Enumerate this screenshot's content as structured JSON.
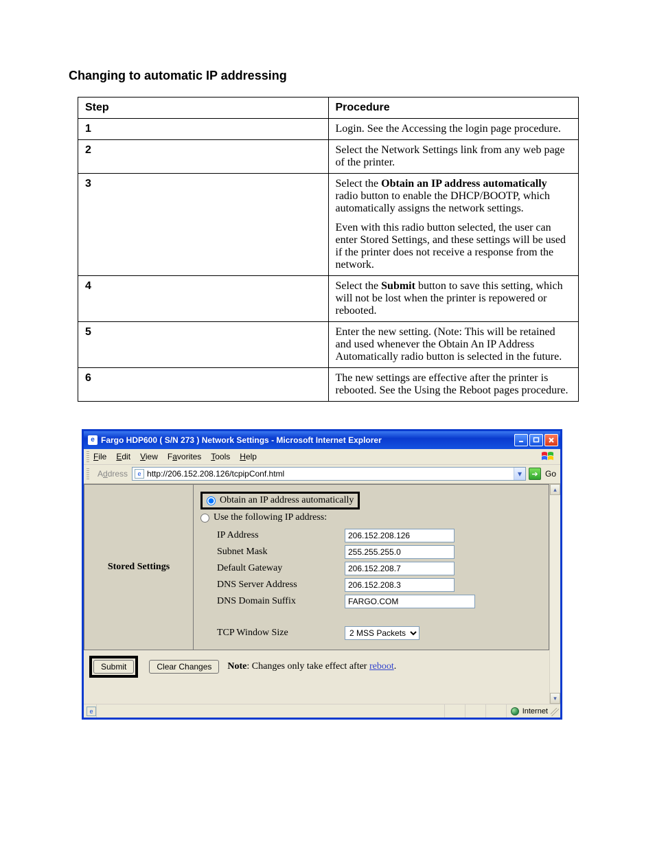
{
  "section_title": "Changing to automatic IP addressing",
  "table": {
    "header_step": "Step",
    "header_proc": "Procedure",
    "rows": [
      {
        "num": "1",
        "text": "Login. See the Accessing the login page procedure."
      },
      {
        "num": "2",
        "text": "Select the Network Settings link from any web page of the printer."
      },
      {
        "num": "3",
        "text_html": "Select the <b>Obtain an IP address automatically</b> radio button to enable the DHCP/BOOTP, which automatically assigns the network settings.",
        "text_note": "Even with this radio button selected, the user can enter Stored Settings, and these settings will be used if the printer does not receive a response from the network."
      },
      {
        "num": "4",
        "text_html": "Select the <b>Submit</b> button to save this setting, which will not be lost when the printer is repowered or rebooted."
      },
      {
        "num": "5",
        "text": "Enter the new setting. (Note: This will be retained and used whenever the Obtain An IP Address Automatically radio button is selected in the future."
      },
      {
        "num": "6",
        "text_html": "The new settings are effective after the printer is rebooted. See the <a>Using the Reboot pages</a> procedure."
      }
    ]
  },
  "window": {
    "title": "Fargo HDP600 ( S/N 273 ) Network Settings - Microsoft Internet Explorer",
    "menu": {
      "file": "File",
      "edit": "Edit",
      "view": "View",
      "favorites": "Favorites",
      "tools": "Tools",
      "help": "Help"
    },
    "address_label": "Address",
    "url": "http://206.152.208.126/tcpipConf.html",
    "go": "Go",
    "stored_label": "Stored Settings",
    "radio_auto": "Obtain an IP address automatically",
    "radio_manual": "Use the following IP address:",
    "fields": {
      "ip_label": "IP Address",
      "ip_value": "206.152.208.126",
      "mask_label": "Subnet Mask",
      "mask_value": "255.255.255.0",
      "gw_label": "Default Gateway",
      "gw_value": "206.152.208.7",
      "dns_label": "DNS Server Address",
      "dns_value": "206.152.208.3",
      "suffix_label": "DNS Domain Suffix",
      "suffix_value": "FARGO.COM",
      "tcp_label": "TCP Window Size",
      "tcp_value": "2 MSS Packets"
    },
    "submit": "Submit",
    "clear": "Clear Changes",
    "note_bold": "Note",
    "note_rest": ": Changes only take effect after ",
    "note_link": "reboot",
    "note_period": ".",
    "zone": "Internet"
  }
}
